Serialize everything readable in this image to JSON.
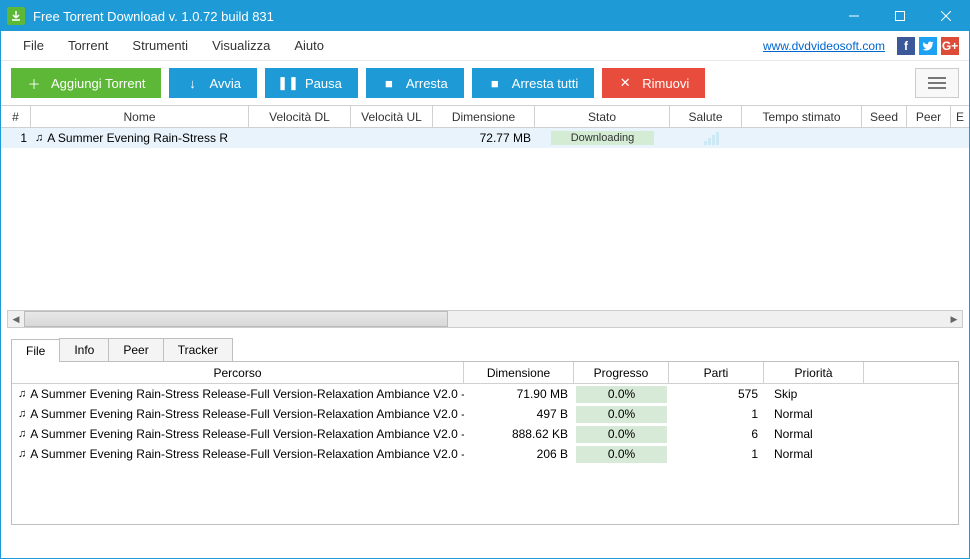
{
  "window": {
    "title": "Free Torrent Download v. 1.0.72 build 831"
  },
  "menu": {
    "items": [
      "File",
      "Torrent",
      "Strumenti",
      "Visualizza",
      "Aiuto"
    ],
    "link": "www.dvdvideosoft.com"
  },
  "toolbar": {
    "add": "Aggiungi Torrent",
    "start": "Avvia",
    "pause": "Pausa",
    "stop": "Arresta",
    "stop_all": "Arresta tutti",
    "remove": "Rimuovi"
  },
  "grid": {
    "cols": {
      "num": "#",
      "name": "Nome",
      "dl": "Velocità DL",
      "ul": "Velocità UL",
      "size": "Dimensione",
      "status": "Stato",
      "health": "Salute",
      "eta": "Tempo stimato",
      "seed": "Seed",
      "peer": "Peer",
      "extra": "E"
    },
    "rows": [
      {
        "num": "1",
        "name": "A Summer Evening Rain-Stress R",
        "dl": "",
        "ul": "",
        "size": "72.77 MB",
        "status": "Downloading"
      }
    ]
  },
  "tabs": {
    "file": "File",
    "info": "Info",
    "peer": "Peer",
    "tracker": "Tracker"
  },
  "fileGrid": {
    "cols": {
      "path": "Percorso",
      "size": "Dimensione",
      "prog": "Progresso",
      "parts": "Parti",
      "prio": "Priorità"
    },
    "rows": [
      {
        "path": "A Summer Evening Rain-Stress Release-Full Version-Relaxation Ambiance V2.0 -",
        "size": "71.90 MB",
        "prog": "0.0%",
        "parts": "575",
        "prio": "Skip"
      },
      {
        "path": "A Summer Evening Rain-Stress Release-Full Version-Relaxation Ambiance V2.0 -",
        "size": "497 B",
        "prog": "0.0%",
        "parts": "1",
        "prio": "Normal"
      },
      {
        "path": "A Summer Evening Rain-Stress Release-Full Version-Relaxation Ambiance V2.0 -",
        "size": "888.62 KB",
        "prog": "0.0%",
        "parts": "6",
        "prio": "Normal"
      },
      {
        "path": "A Summer Evening Rain-Stress Release-Full Version-Relaxation Ambiance V2.0 -",
        "size": "206 B",
        "prog": "0.0%",
        "parts": "1",
        "prio": "Normal"
      }
    ]
  }
}
